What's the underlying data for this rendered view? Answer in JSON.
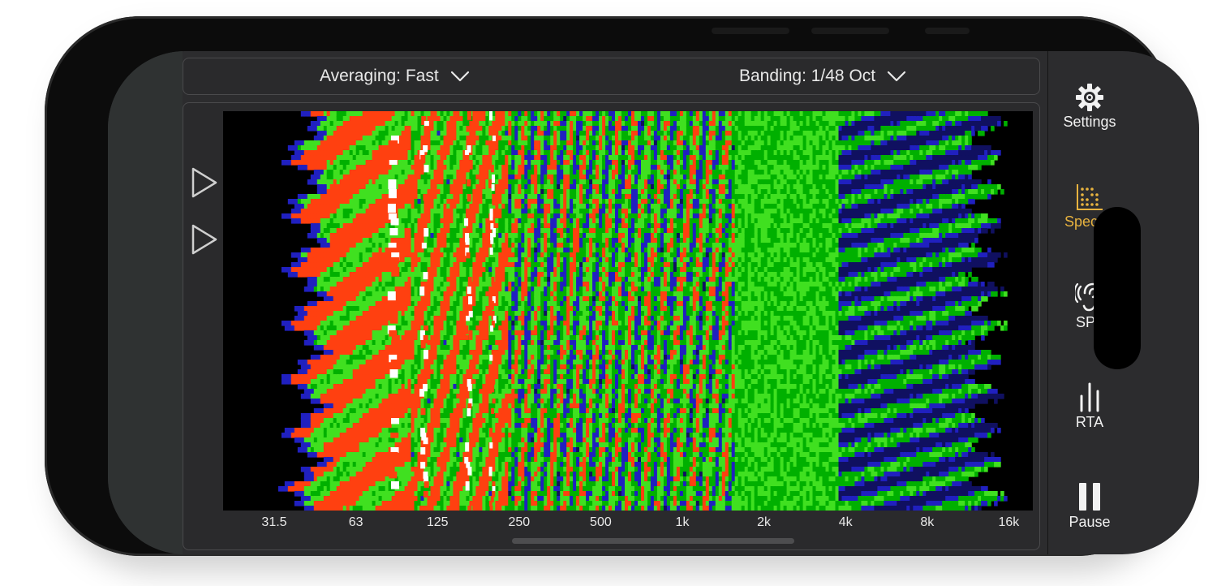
{
  "toolbar": {
    "averaging_label": "Averaging: Fast",
    "banding_label": "Banding: 1/48 Oct"
  },
  "frequency_axis": {
    "ticks": [
      "31.5",
      "63",
      "125",
      "250",
      "500",
      "1k",
      "2k",
      "4k",
      "8k",
      "16k"
    ]
  },
  "sidebar": {
    "items": [
      {
        "label": "Settings",
        "icon": "gear-icon",
        "active": false
      },
      {
        "label": "Spectro",
        "icon": "spectrogram-icon",
        "active": true
      },
      {
        "label": "SPL",
        "icon": "ear-icon",
        "active": false
      },
      {
        "label": "RTA",
        "icon": "bars-icon",
        "active": false
      },
      {
        "label": "Pause",
        "icon": "pause-icon",
        "active": false
      }
    ]
  },
  "colors": {
    "accent": "#e8b33f",
    "spectrogram_palette": [
      "#000000",
      "#101060",
      "#2020c0",
      "#00b000",
      "#40e020",
      "#ff4010",
      "#ffffff"
    ]
  }
}
